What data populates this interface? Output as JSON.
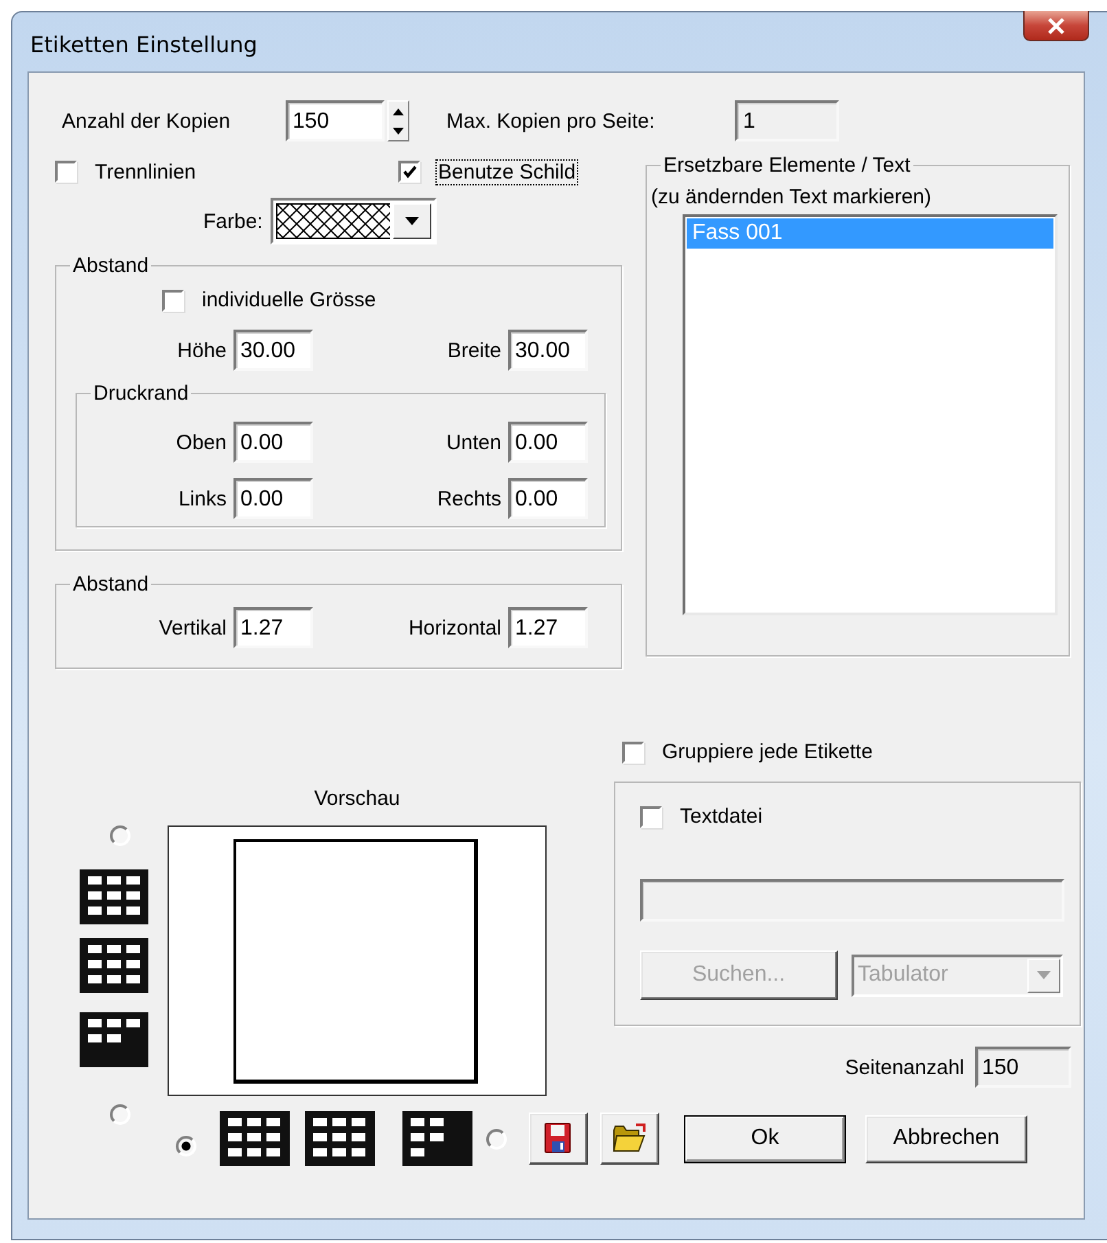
{
  "window": {
    "title": "Etiketten Einstellung"
  },
  "copies": {
    "label": "Anzahl der Kopien",
    "value": "150"
  },
  "max_per_page": {
    "label": "Max. Kopien pro Seite:",
    "value": "1",
    "readonly": true
  },
  "options": [
    {
      "label": "Trennlinien",
      "checked": false,
      "focused": false
    },
    {
      "label": "Benutze Schild",
      "checked": true,
      "focused": true
    }
  ],
  "color": {
    "label": "Farbe:"
  },
  "size_group": {
    "title": "Abstand",
    "individual_size": {
      "label": "individuelle Grösse",
      "checked": false
    },
    "fields": [
      {
        "label": "Höhe",
        "value": "30.00"
      },
      {
        "label": "Breite",
        "value": "30.00"
      }
    ],
    "print_margin": {
      "title": "Druckrand",
      "fields": [
        {
          "label": "Oben",
          "value": "0.00"
        },
        {
          "label": "Unten",
          "value": "0.00"
        },
        {
          "label": "Links",
          "value": "0.00"
        },
        {
          "label": "Rechts",
          "value": "0.00"
        }
      ]
    }
  },
  "spacing_group": {
    "title": "Abstand",
    "fields": [
      {
        "label": "Vertikal",
        "value": "1.27"
      },
      {
        "label": "Horizontal",
        "value": "1.27"
      }
    ]
  },
  "replace_group": {
    "title": "Ersetzbare Elemente / Text",
    "hint": "(zu ändernden Text markieren)",
    "items": [
      {
        "label": "Fass 001",
        "selected": true
      }
    ]
  },
  "group_each_label": {
    "label": "Gruppiere jede Etikette",
    "checked": false
  },
  "text_file_group": {
    "checkbox": {
      "label": "Textdatei",
      "checked": false
    },
    "path_field": {
      "disabled": true
    },
    "search_button": {
      "label": "Suchen...",
      "disabled": true
    },
    "separator": {
      "value": "Tabulator",
      "disabled": true
    }
  },
  "page_count": {
    "label": "Seitenanzahl",
    "value": "150",
    "readonly": true
  },
  "preview": {
    "title": "Vorschau"
  },
  "layout_options": [
    {
      "selected": false
    },
    {
      "selected": false
    },
    {
      "selected": true
    },
    {
      "selected": false
    }
  ],
  "buttons": [
    {
      "label": "Ok",
      "default": true
    },
    {
      "label": "Abbrechen",
      "default": false
    }
  ]
}
